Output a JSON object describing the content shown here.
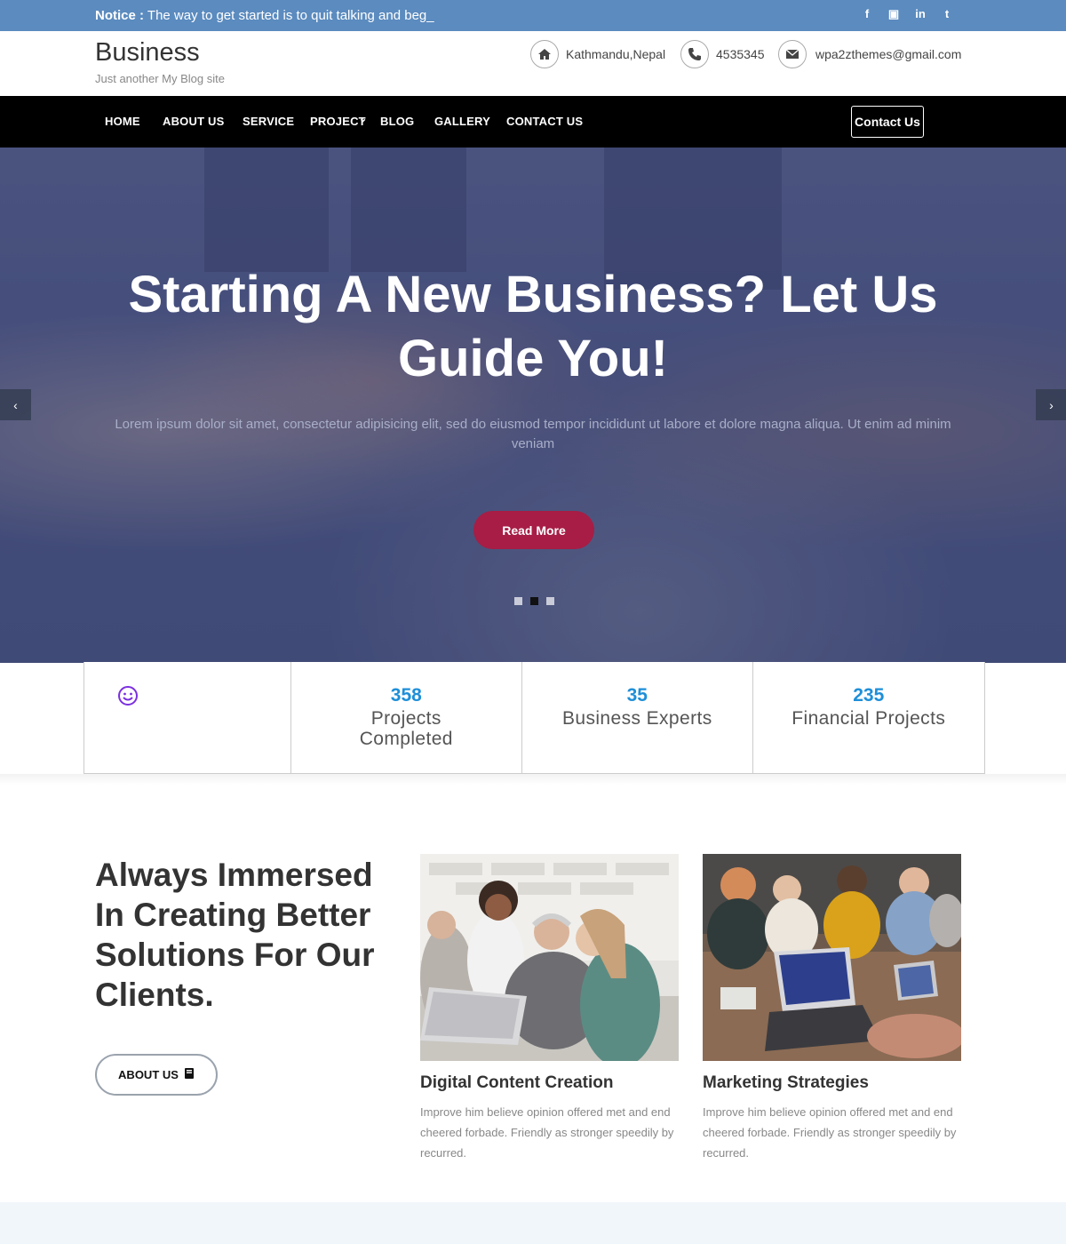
{
  "notice": {
    "label": "Notice :",
    "text": "The way to get started is to quit talking and beg_"
  },
  "social": [
    {
      "icon": "facebook-icon",
      "glyph": "f"
    },
    {
      "icon": "youtube-icon",
      "glyph": "▣"
    },
    {
      "icon": "linkedin-icon",
      "glyph": "in"
    },
    {
      "icon": "twitter-icon",
      "glyph": "t"
    }
  ],
  "header": {
    "title": "Business",
    "subtitle": "Just another My Blog site",
    "location": "Kathmandu,Nepal",
    "phone": "4535345",
    "email": "wpa2zthemes@gmail.com"
  },
  "nav": {
    "items": [
      "HOME",
      "ABOUT US",
      "SERVICE",
      "PROJECT",
      "BLOG",
      "GALLERY",
      "CONTACT US"
    ],
    "cta": "Contact Us"
  },
  "hero": {
    "title": "Starting A New Business? Let Us Guide You!",
    "text": "Lorem ipsum dolor sit amet, consectetur adipisicing elit, sed do eiusmod tempor incididunt ut labore et dolore magna aliqua. Ut enim ad minim veniam",
    "button": "Read More",
    "active_slide": 2,
    "slide_count": 3
  },
  "stats": [
    {
      "value": "",
      "label": ""
    },
    {
      "value": "358",
      "label": "Projects Completed"
    },
    {
      "value": "35",
      "label": "Business Experts"
    },
    {
      "value": "235",
      "label": "Financial Projects"
    }
  ],
  "about": {
    "title": "Always Immersed In Creating Better Solutions For Our Clients.",
    "button": "ABOUT US"
  },
  "cards": [
    {
      "title": "Digital Content Creation",
      "text": "Improve him believe opinion offered met and end cheered forbade. Friendly as stronger speedily by recurred."
    },
    {
      "title": "Marketing Strategies",
      "text": "Improve him believe opinion offered met and end cheered forbade. Friendly as stronger speedily by recurred."
    }
  ],
  "colors": {
    "notice_bar": "#5b8bbf",
    "accent": "#a71d45",
    "stat_number": "#1e8fd8"
  }
}
